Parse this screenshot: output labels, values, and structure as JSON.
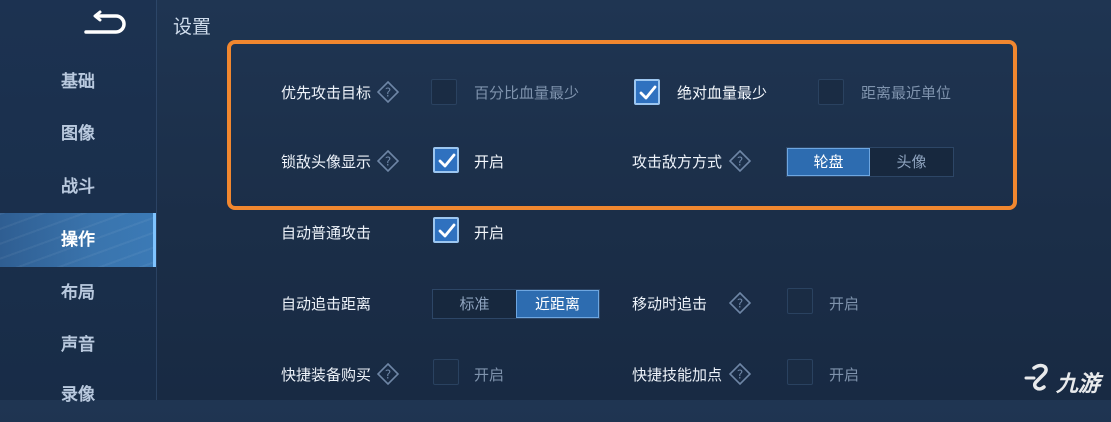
{
  "sidebar": {
    "items": [
      {
        "label": "基础",
        "active": false
      },
      {
        "label": "图像",
        "active": false
      },
      {
        "label": "战斗",
        "active": false
      },
      {
        "label": "操作",
        "active": true
      },
      {
        "label": "布局",
        "active": false
      },
      {
        "label": "声音",
        "active": false
      },
      {
        "label": "录像",
        "active": false
      }
    ]
  },
  "page_title": "设置",
  "settings": {
    "priority_target": {
      "label": "优先攻击目标",
      "options": [
        {
          "label": "百分比血量最少",
          "checked": false
        },
        {
          "label": "绝对血量最少",
          "checked": true
        },
        {
          "label": "距离最近单位",
          "checked": false
        }
      ]
    },
    "lock_avatar": {
      "label": "锁敌头像显示",
      "option": "开启",
      "checked": true
    },
    "attack_mode": {
      "label": "攻击敌方方式",
      "options": [
        "轮盘",
        "头像"
      ],
      "selected": "轮盘"
    },
    "auto_attack": {
      "label": "自动普通攻击",
      "option": "开启",
      "checked": true
    },
    "chase_distance": {
      "label": "自动追击距离",
      "options": [
        "标准",
        "近距离"
      ],
      "selected": "近距离"
    },
    "move_chase": {
      "label": "移动时追击",
      "option": "开启",
      "checked": false
    },
    "quick_buy": {
      "label": "快捷装备购买",
      "option": "开启",
      "checked": false
    },
    "quick_skill": {
      "label": "快捷技能加点",
      "option": "开启",
      "checked": false
    }
  },
  "watermark": {
    "text": "九游"
  },
  "colors": {
    "highlight": "#f1872f",
    "checkbox_on": "#2f71bf",
    "segment_on": "#2d6cb0"
  }
}
